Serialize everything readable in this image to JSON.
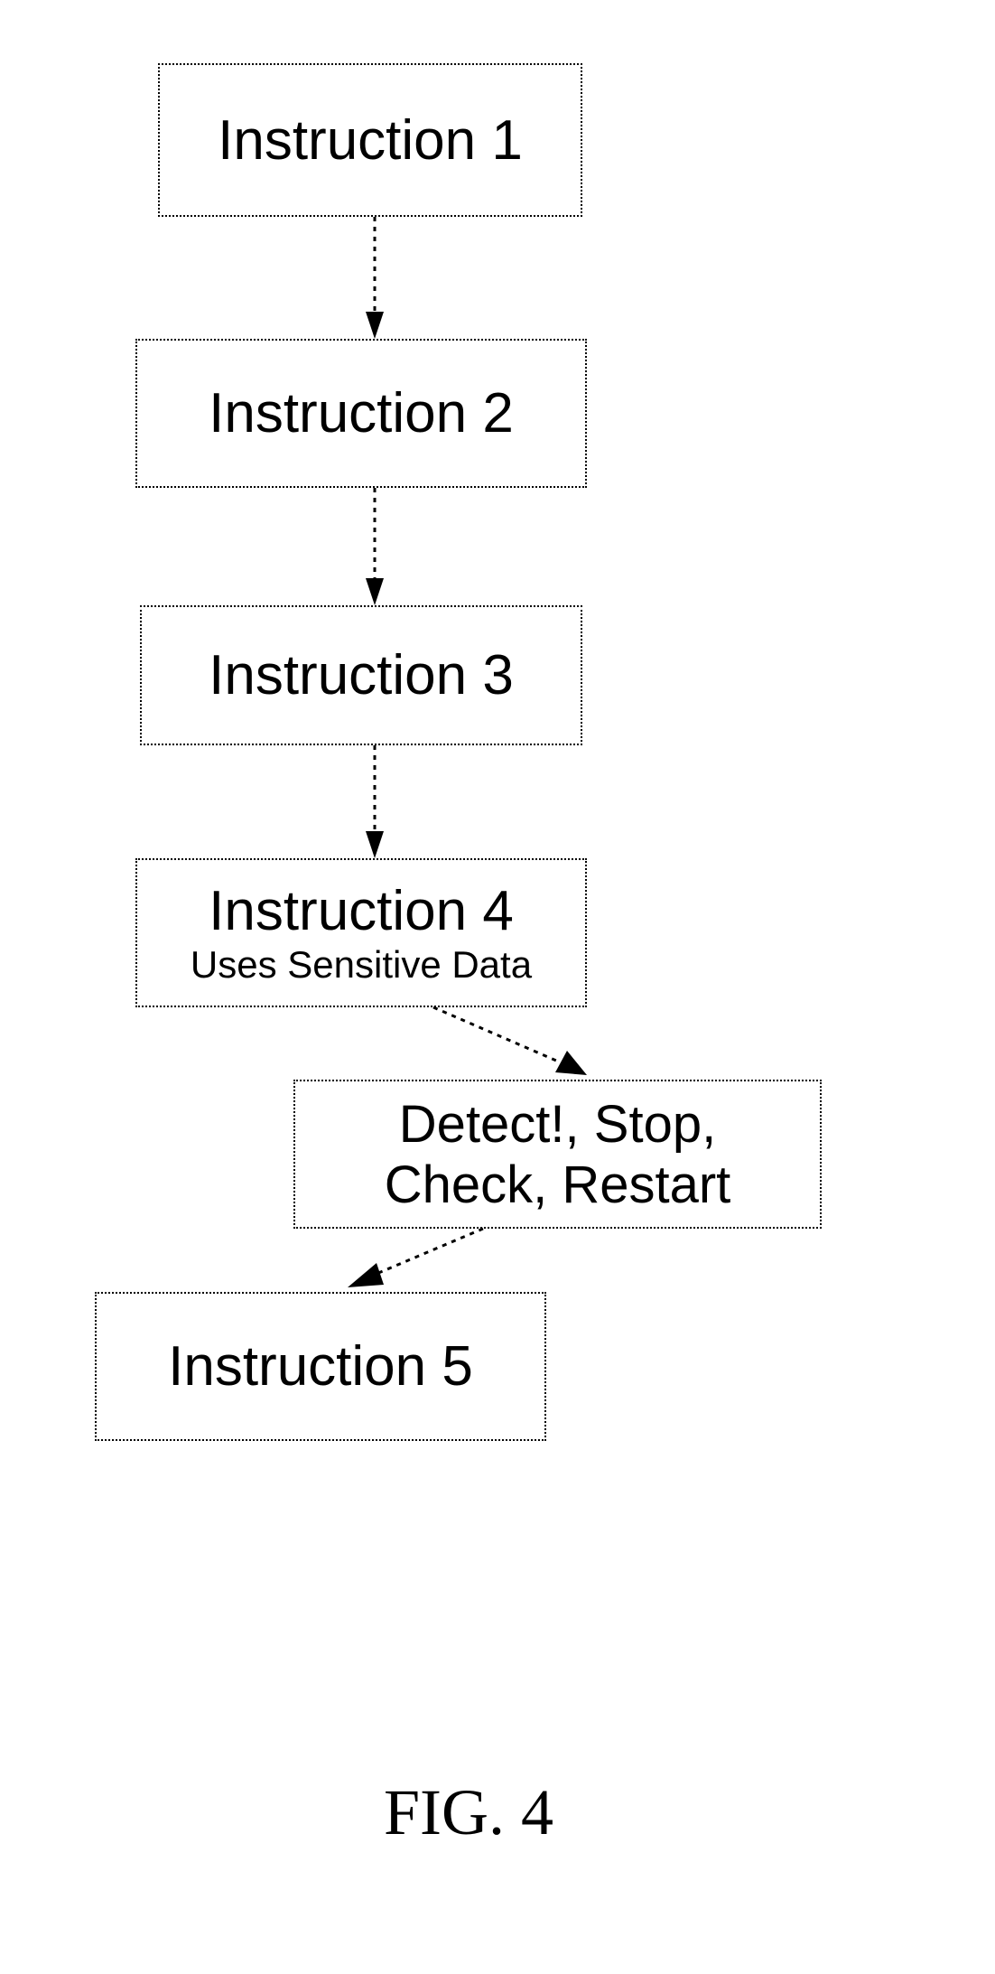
{
  "chart_data": {
    "type": "flowchart",
    "nodes": [
      {
        "id": "n1",
        "label": "Instruction 1"
      },
      {
        "id": "n2",
        "label": "Instruction 2"
      },
      {
        "id": "n3",
        "label": "Instruction 3"
      },
      {
        "id": "n4",
        "label": "Instruction 4",
        "sub": "Uses Sensitive Data"
      },
      {
        "id": "nD",
        "label": "Detect!, Stop, Check, Restart"
      },
      {
        "id": "n5",
        "label": "Instruction 5"
      }
    ],
    "edges": [
      {
        "from": "n1",
        "to": "n2"
      },
      {
        "from": "n2",
        "to": "n3"
      },
      {
        "from": "n3",
        "to": "n4"
      },
      {
        "from": "n4",
        "to": "nD"
      },
      {
        "from": "nD",
        "to": "n5"
      }
    ]
  },
  "boxes": {
    "b1": {
      "label": "Instruction 1"
    },
    "b2": {
      "label": "Instruction 2"
    },
    "b3": {
      "label": "Instruction 3"
    },
    "b4": {
      "label": "Instruction 4",
      "sub": "Uses Sensitive Data"
    },
    "bD": {
      "line1": "Detect!, Stop,",
      "line2": "Check, Restart"
    },
    "b5": {
      "label": "Instruction 5"
    }
  },
  "caption": "FIG. 4"
}
